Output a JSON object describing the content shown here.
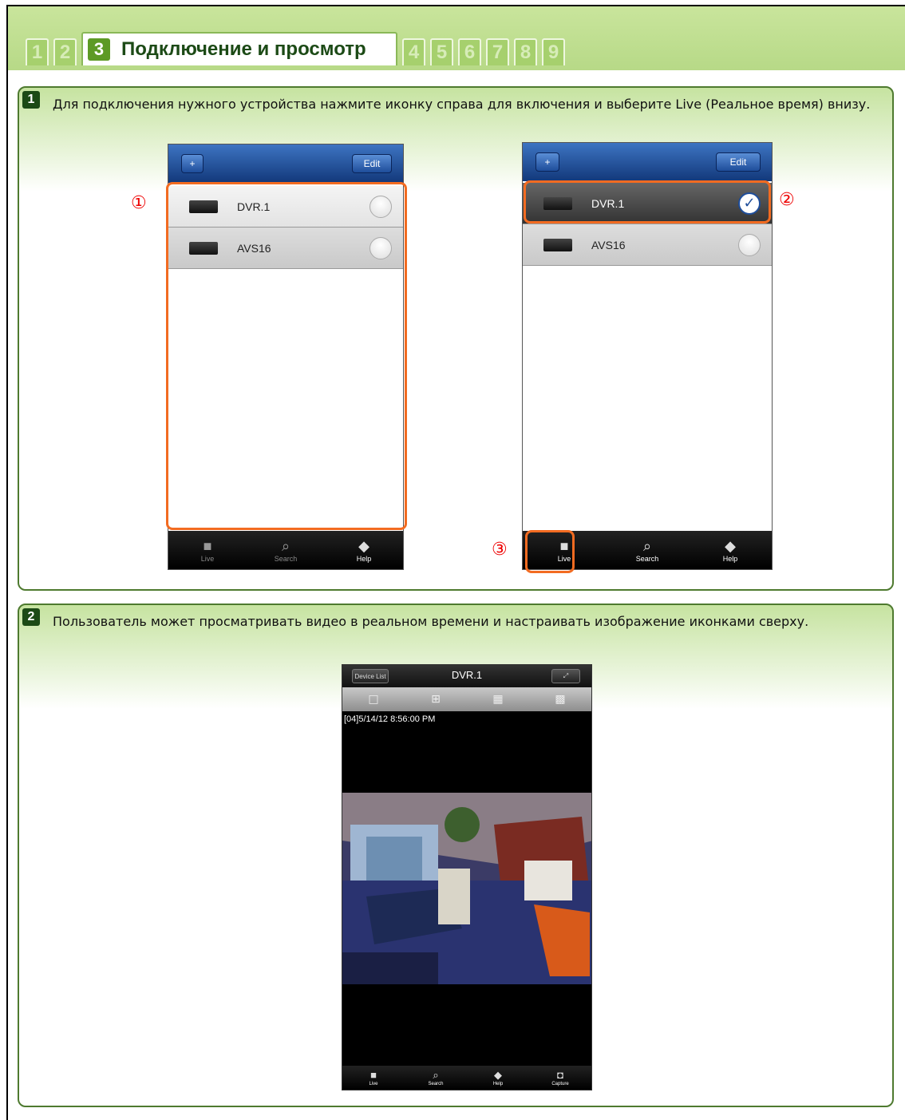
{
  "tabs": [
    {
      "num": "1"
    },
    {
      "num": "2"
    },
    {
      "num": "3",
      "title": "Подключение и просмотр"
    },
    {
      "num": "4"
    },
    {
      "num": "5"
    },
    {
      "num": "6"
    },
    {
      "num": "7"
    },
    {
      "num": "8"
    },
    {
      "num": "9"
    }
  ],
  "section1": {
    "step": "1",
    "text": "Для подключения нужного устройства нажмите иконку справа для включения и выберите Live (Реальное время) внизу.",
    "add_label": "+",
    "edit_label": "Edit",
    "devices": [
      "DVR.1",
      "AVS16"
    ],
    "marker1": "①",
    "marker2": "②",
    "marker3": "③",
    "tabbar": {
      "live": "Live",
      "search": "Search",
      "help": "Help"
    }
  },
  "section2": {
    "step": "2",
    "text": "Пользователь может просматривать видео в реальном времени и настраивать изображение иконками сверху.",
    "device_list_label": "Device List",
    "title": "DVR.1",
    "timestamp": "[04]5/14/12 8:56:00 PM",
    "tabbar": {
      "live": "Live",
      "search": "Search",
      "help": "Help",
      "capture": "Capture"
    }
  },
  "colors": {
    "accent_green": "#5d9a25",
    "highlight": "#f26b21",
    "ios_blue": "#1e4d9a"
  }
}
